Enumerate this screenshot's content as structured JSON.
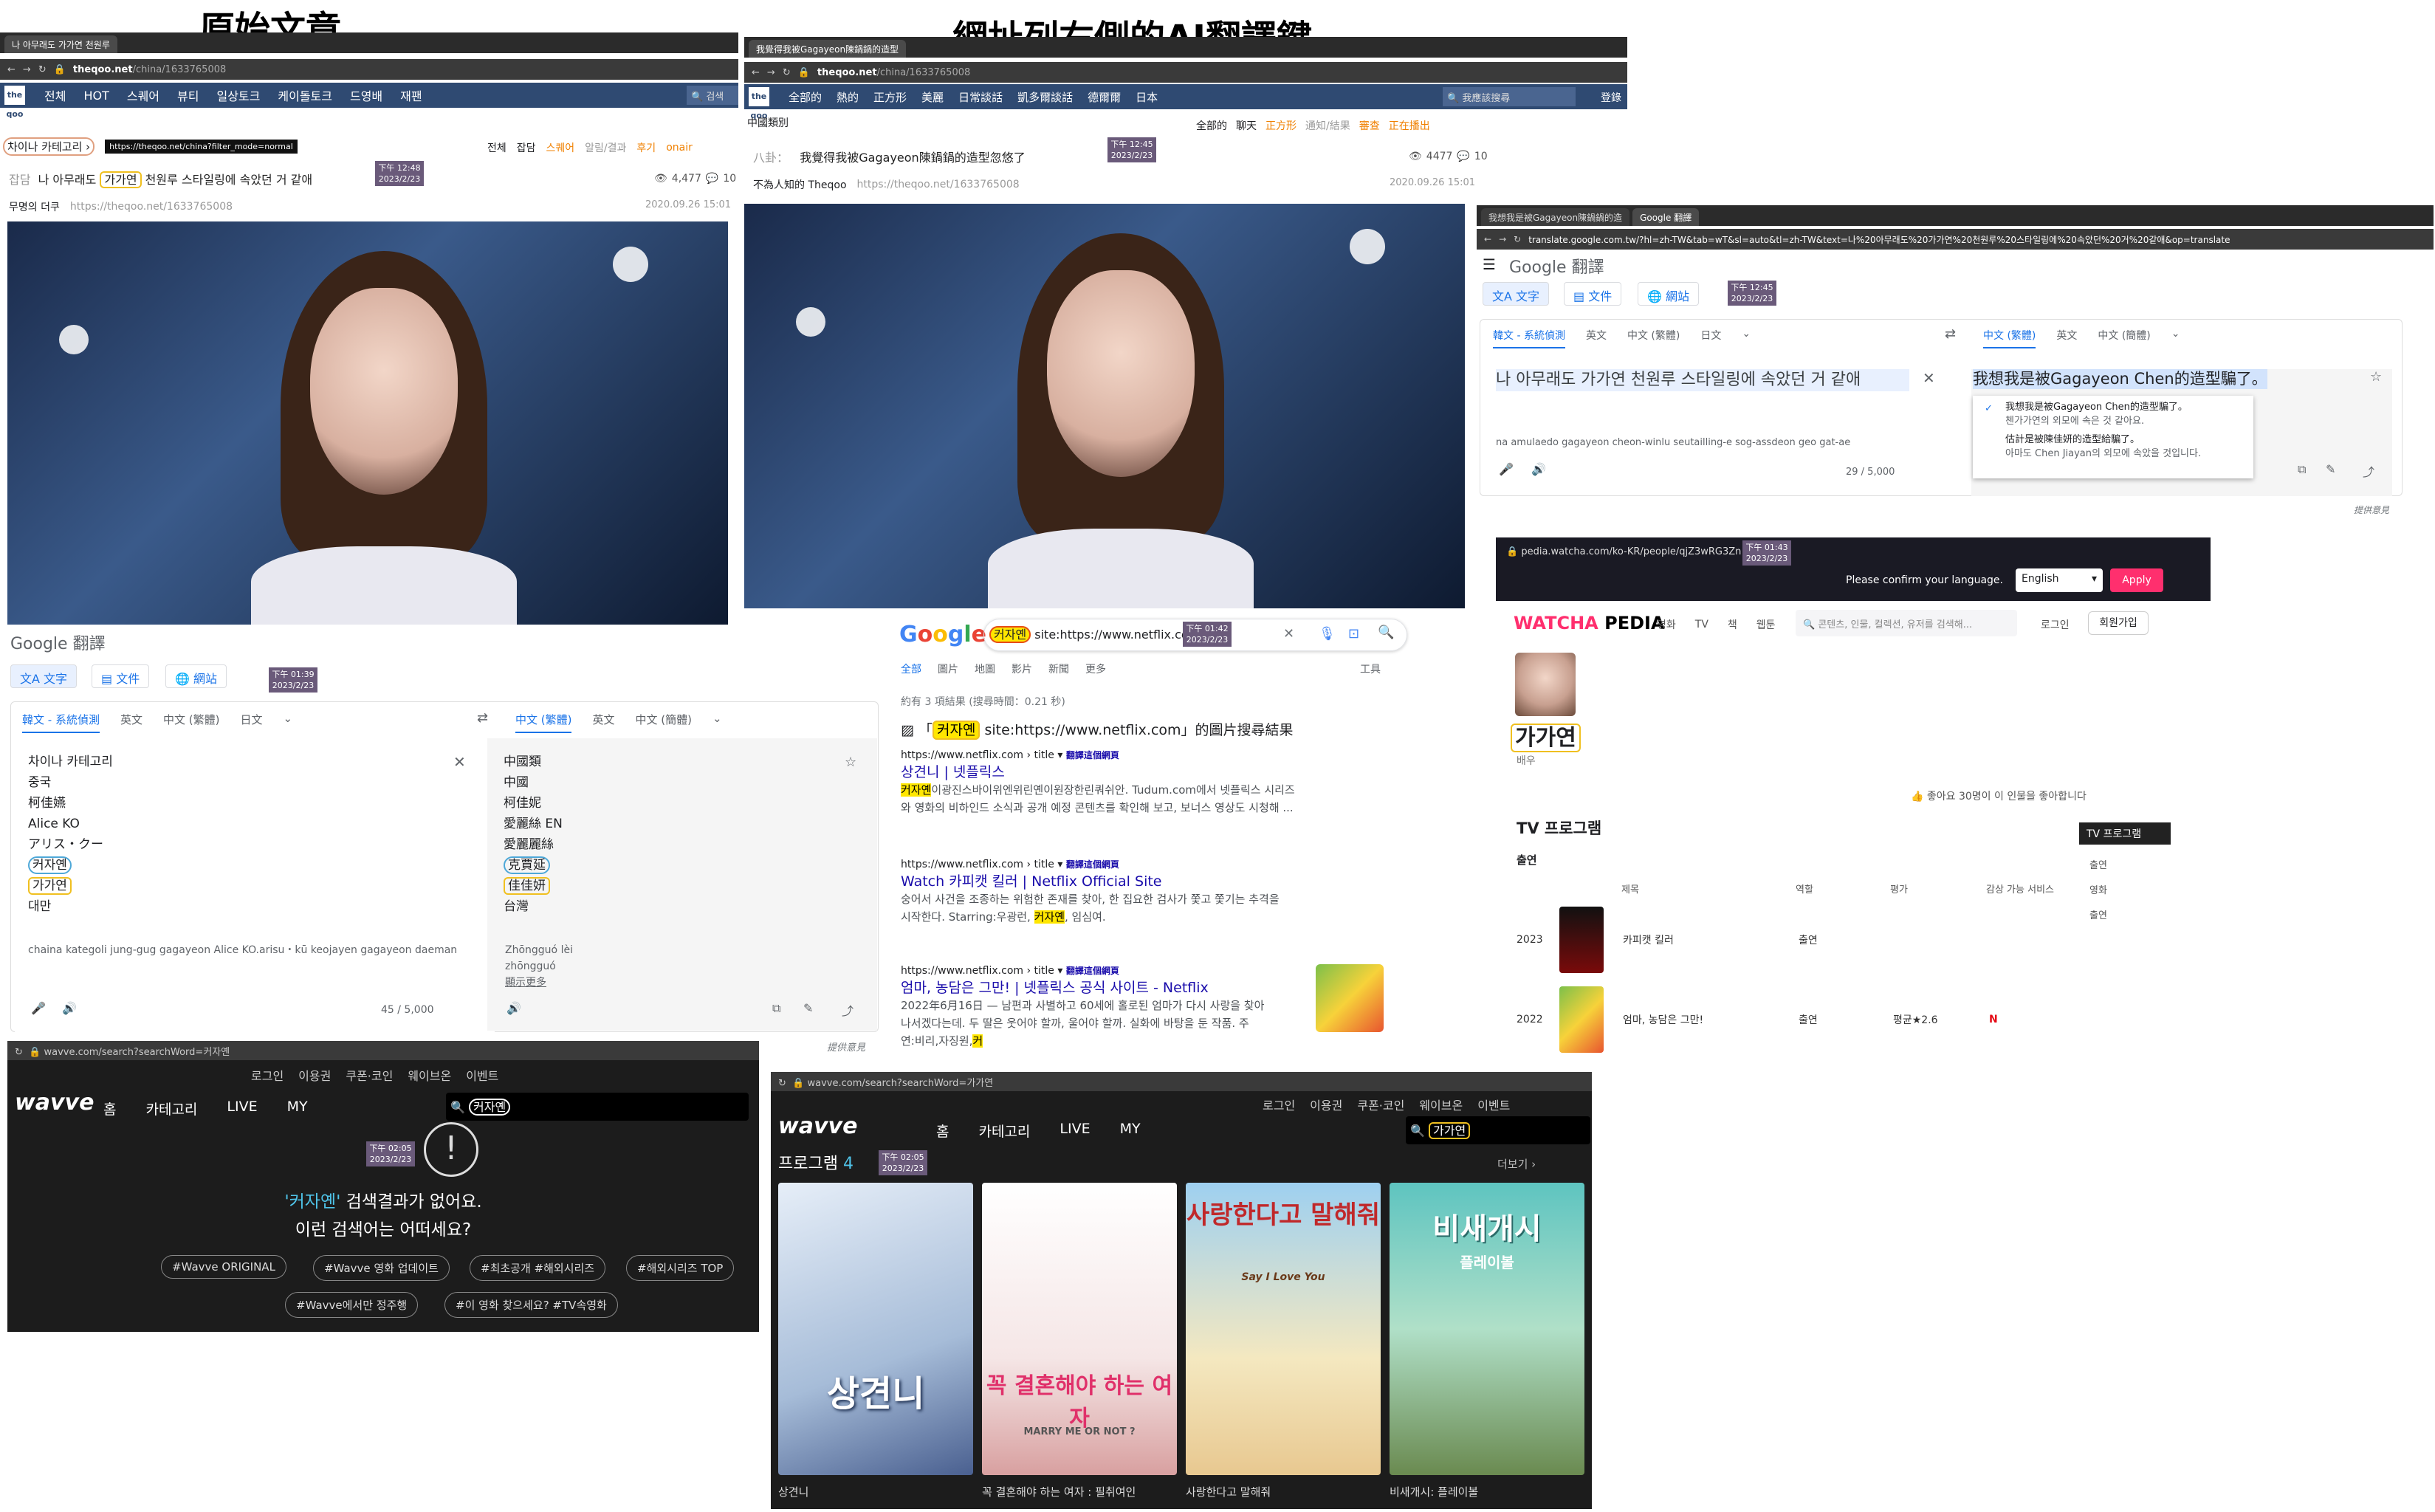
{
  "headings": {
    "left": "原始文章",
    "right": "網址列右側的AI翻譯鍵"
  },
  "win1": {
    "tab": "나 아무래도 가가연 천원루",
    "url_host": "theqoo.net",
    "url_path": "/china/1633765008",
    "nav": [
      "전체",
      "HOT",
      "스퀘어",
      "뷰티",
      "일상토크",
      "케이돌토크",
      "드영배",
      "재팬"
    ],
    "search_hint": "검색",
    "category": "차이나 카테고리",
    "tooltip_url": "https://theqoo.net/china?filter_mode=normal",
    "filters": [
      "전체",
      "잡담",
      "스퀘어",
      "알림/결과",
      "후기",
      "onair"
    ],
    "post_prefix": "잡담",
    "post_title_a": "나 아무래도 ",
    "post_title_hl": "가가연",
    "post_title_b": " 천원루 스타일링에 속았던 거 같애",
    "time": "下午 12:48",
    "date": "2023/2/23",
    "views": "4,477",
    "comments": "10",
    "author": "무명의 더쿠",
    "link": "https://theqoo.net/1633765008",
    "posted": "2020.09.26 15:01"
  },
  "win2": {
    "tab": "我覺得我被Gagayeon陳鍋鍋的造型",
    "url_host": "theqoo.net",
    "url_path": "/china/1633765008",
    "nav": [
      "全部的",
      "熱的",
      "正方形",
      "美麗",
      "日常談話",
      "凱多爾談話",
      "德爾爾",
      "日本"
    ],
    "search_hint": "我應該搜尋",
    "login": "登錄",
    "category": "中國類別",
    "filters": [
      "全部的",
      "聊天",
      "正方形",
      "通知/結果",
      "審查",
      "正在播出"
    ],
    "post_prefix": "八卦：",
    "post_title": "我覺得我被Gagayeon陳鍋鍋的造型忽悠了",
    "time": "下午 12:45",
    "date": "2023/2/23",
    "views": "4477",
    "comments": "10",
    "author": "不為人知的 Theqoo",
    "link": "https://theqoo.net/1633765008",
    "posted": "2020.09.26 15:01"
  },
  "win3": {
    "tab1": "我想我是被Gagayeon陳鍋鍋的造",
    "tab2": "Google 翻譯",
    "url": "translate.google.com.tw/?hl=zh-TW&tab=wT&sl=auto&tl=zh-TW&text=나%20아무래도%20가가연%20천원루%20스타일링에%20속았던%20거%20같애&op=translate",
    "logo": "Google 翻譯",
    "btns": [
      "文字",
      "文件",
      "網站"
    ],
    "time": "下午 12:45",
    "date": "2023/2/23",
    "src_langs": [
      "韓文 - 系統偵測",
      "英文",
      "中文 (繁體)",
      "日文"
    ],
    "tgt_langs": [
      "中文 (繁體)",
      "英文",
      "中文 (簡體)"
    ],
    "src_text": "나 아무래도 가가연 천원루 스타일링에 속았던 거 같애",
    "romanized": "na amulaedo gagayeon cheon-winlu seutailling-e sog-assdeon geo gat-ae",
    "count": "29 / 5,000",
    "result": "我想我是被Gagayeon Chen的造型騙了。",
    "alt1": "我想我是被Gagayeon Chen的造型騙了。",
    "alt1b": "첸가가연의 외모에 속은 것 같아요.",
    "alt2": "估計是被陳佳妍的造型給騙了。",
    "alt2b": "아마도 Chen Jiayan의 외모에 속았을 것입니다.",
    "feedback": "提供意見"
  },
  "win4": {
    "logo": "Google 翻譯",
    "btns": [
      "文字",
      "文件",
      "網站"
    ],
    "time": "下午 01:39",
    "date": "2023/2/23",
    "src_langs": [
      "韓文 - 系統偵測",
      "英文",
      "中文 (繁體)",
      "日文"
    ],
    "tgt_langs": [
      "中文 (繁體)",
      "英文",
      "中文 (簡體)"
    ],
    "src_lines": [
      "차이나 카테고리",
      "중국",
      "柯佳嬿",
      "Alice KO",
      "アリス・クー",
      "커자옌",
      "가가연",
      "대만"
    ],
    "tgt_lines": [
      "中國類",
      "中國",
      "柯佳妮",
      "愛麗絲 EN",
      "愛麗麗絲",
      "克賈延",
      "佳佳妍",
      "台灣"
    ],
    "romanized": "chaina kategoli jung-gug gagayeon Alice KO.arisu・kū keojayen gagayeon daeman",
    "pinyin1": "Zhōngguó lèi",
    "pinyin2": "zhōngguó",
    "more": "顯示更多",
    "count": "45 / 5,000",
    "feedback": "提供意見"
  },
  "win5": {
    "query_hl": "커자옌",
    "query_rest": " site:https://www.netflix.com",
    "time": "下午 01:42",
    "date": "2023/2/23",
    "tabs": [
      "全部",
      "圖片",
      "地圖",
      "影片",
      "新聞",
      "更多"
    ],
    "tools": "工具",
    "stats": "約有 3 項結果 (搜尋時間：0.21 秒)",
    "img_line_a": "「",
    "img_line_hl": "커자옌",
    "img_line_b": " site:https://www.netflix.com」的圖片搜尋結果",
    "translate": "翻譯這個網頁",
    "r1_cite": "https://www.netflix.com › title",
    "r1_title": "상견니 | 넷플릭스",
    "r1_snip_hl": "커자옌",
    "r1_snip": "이광진스바이위엔위린옌이원장한린쿼쉬안. Tudum.com에서 넷플릭스 시리즈",
    "r1_snip2": "와 영화의 비하인드 소식과 공개 예정 콘텐츠를 확인해 보고, 보너스 영상도 시청해 ...",
    "r2_cite": "https://www.netflix.com › title",
    "r2_title": "Watch 카피캣 킬러 | Netflix Official Site",
    "r2_snip": "숭어서 사건을 조종하는 위험한 존재를 찾아, 한 집요한 검사가 쫓고 쫓기는 추격을",
    "r2_snip2a": "시작한다. Starring:우광런, ",
    "r2_snip2hl": "커자옌",
    "r2_snip2b": ", 임심여.",
    "r3_cite": "https://www.netflix.com › title",
    "r3_title": "엄마, 농담은 그만! | 넷플릭스 공식 사이트 - Netflix",
    "r3_snip": "2022年6月16日 — 남편과 사별하고 60세에 홀로된 엄마가 다시 사랑을 찾아",
    "r3_snip2": "나서겠다는데. 두 딸은 웃어야 할까, 울어야 할까. 실화에 바탕을 둔 작품. 주",
    "r3_snip3a": "연:비리,자징원,",
    "r3_snip3hl": "커",
    "feedback": "提供意見"
  },
  "win6": {
    "url": "pedia.watcha.com/ko-KR/people/qjZ3wRG3Zn",
    "time": "下午 01:43",
    "date": "2023/2/23",
    "lang_prompt": "Please confirm your language.",
    "lang_sel": "English",
    "apply": "Apply",
    "logo": "WATCHA PEDIA",
    "nav": [
      "영화",
      "TV",
      "책",
      "웹툰"
    ],
    "search_ph": "콘텐츠, 인물, 컬렉션, 유저를 검색해...",
    "login": "로그인",
    "signup": "회원가입",
    "name": "가가연",
    "role": "배우",
    "likes": "좋아요 30명이 이 인물을 좋아합니다",
    "section": "TV 프로그램",
    "sub": "출연",
    "side_tab": "TV 프로그램",
    "side_items": [
      "출연",
      "영화",
      "출연"
    ],
    "cols": [
      "제목",
      "역할",
      "평가",
      "감상 가능 서비스"
    ],
    "rows": [
      {
        "year": "2023",
        "title": "카피캣 킬러",
        "role": "출연",
        "rating": "",
        "svc": ""
      },
      {
        "year": "2022",
        "title": "엄마, 농담은 그만!",
        "role": "출연",
        "rating": "평균★2.6",
        "svc": "N"
      }
    ]
  },
  "win7": {
    "url": "wavve.com/search?searchWord=커자옌",
    "top": [
      "로그인",
      "이용권",
      "쿠폰·코인",
      "웨이브온",
      "이벤트"
    ],
    "logo": "wavve",
    "nav": [
      "홈",
      "카테고리",
      "LIVE",
      "MY"
    ],
    "query": "커자옌",
    "time": "下午 02:05",
    "date": "2023/2/23",
    "empty_a": "'커자옌'",
    "empty_b": " 검색결과가 없어요.",
    "suggest": "이런 검색어는 어떠세요?",
    "pills": [
      "#Wavve ORIGINAL",
      "#Wavve 영화 업데이트",
      "#최초공개 #해외시리즈",
      "#해외시리즈 TOP",
      "#Wavve에서만 정주행",
      "#이 영화 찾으세요? #TV속영화"
    ]
  },
  "win8": {
    "url": "wavve.com/search?searchWord=가가연",
    "top": [
      "로그인",
      "이용권",
      "쿠폰·코인",
      "웨이브온",
      "이벤트"
    ],
    "logo": "wavve",
    "nav": [
      "홈",
      "카테고리",
      "LIVE",
      "MY"
    ],
    "query": "가가연",
    "section": "프로그램",
    "count": "4",
    "time": "下午 02:05",
    "date": "2023/2/23",
    "more": "더보기",
    "posters": [
      {
        "art": "상견니",
        "caption": "상견니"
      },
      {
        "art": "꼭 결혼해야 하는 여자",
        "caption": "꼭 결혼해야 하는 여자 : 필취여인"
      },
      {
        "art": "사랑한다고 말해줘",
        "caption": "사랑한다고 말해줘"
      },
      {
        "art": "비새개시",
        "caption": "비새개시: 플레이볼"
      }
    ],
    "poster_sub3": "Say I Love You",
    "poster_sub4": "플레이볼",
    "poster_sub2": "MARRY ME OR NOT ?"
  }
}
